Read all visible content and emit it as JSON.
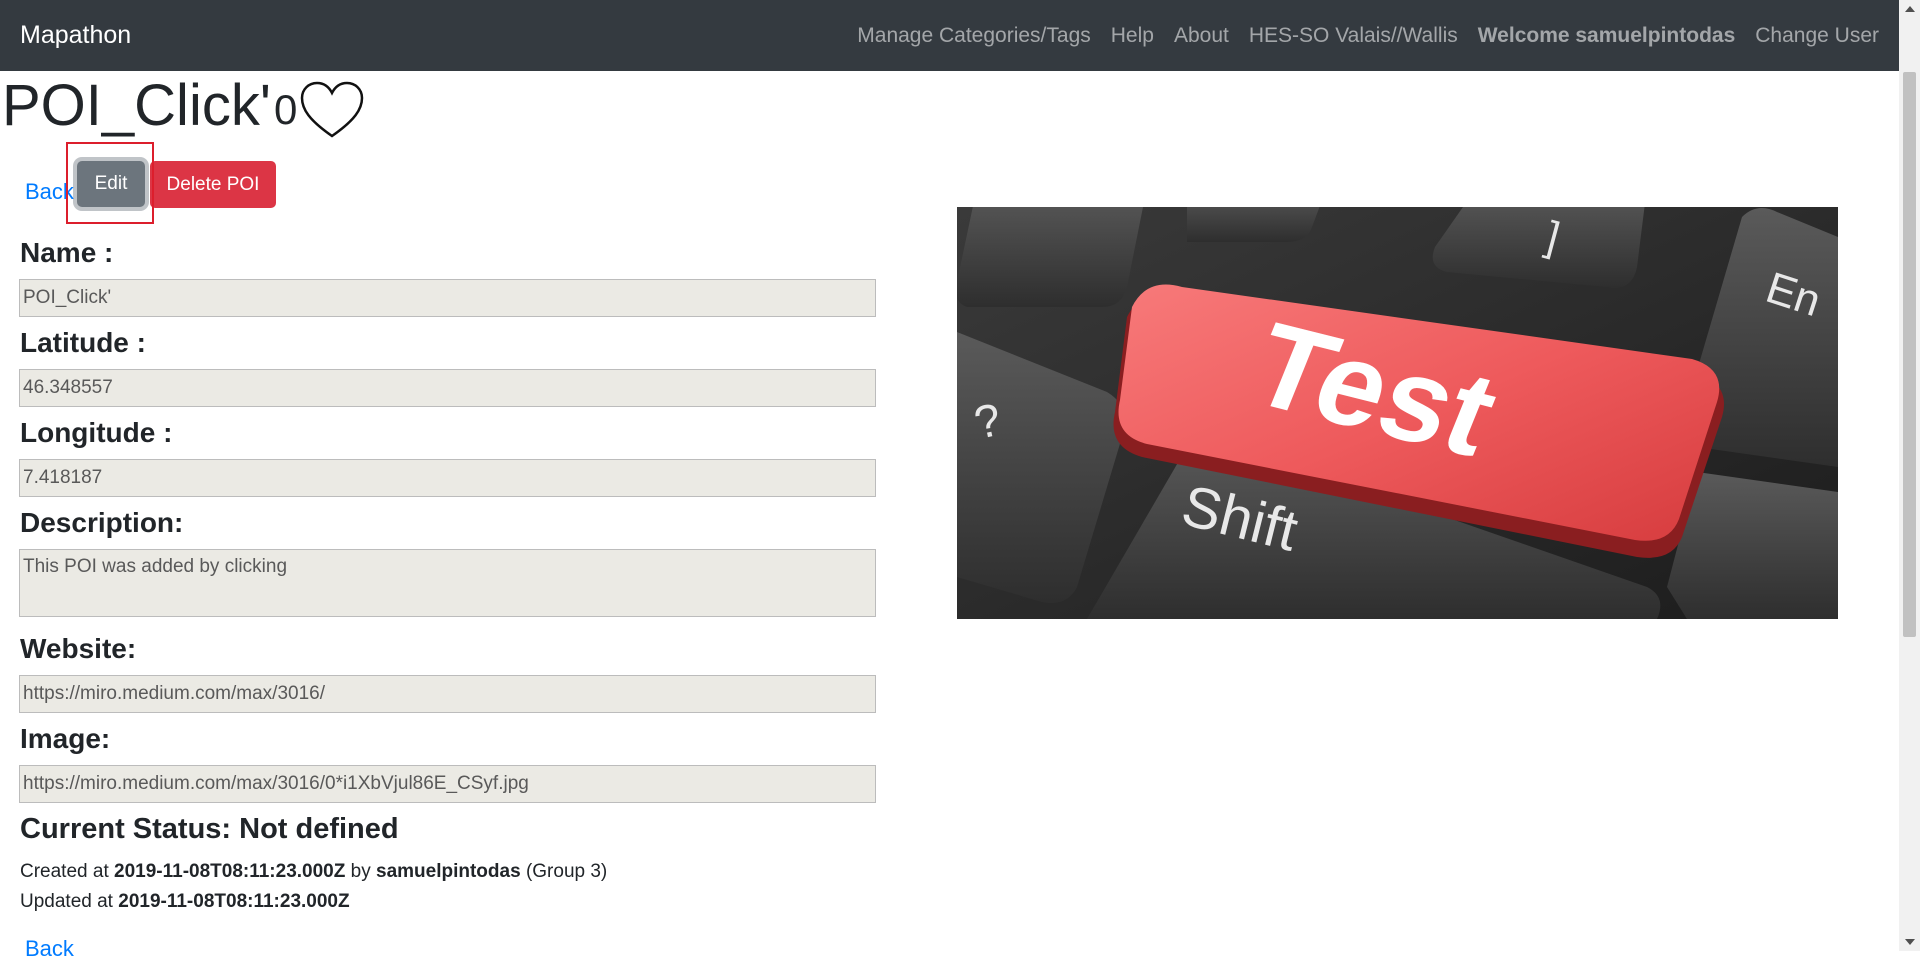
{
  "navbar": {
    "brand": "Mapathon",
    "links": [
      "Manage Categories/Tags",
      "Help",
      "About",
      "HES-SO Valais//Wallis"
    ],
    "welcome": "Welcome samuelpintodas",
    "change_user": "Change User"
  },
  "poi": {
    "title": "POI_Click'",
    "likes": "0",
    "heart_icon": "heart-outline-icon"
  },
  "actions": {
    "back": "Back",
    "edit": "Edit",
    "delete": "Delete POI"
  },
  "form": {
    "name_label": "Name :",
    "name_value": "POI_Click'",
    "latitude_label": "Latitude :",
    "latitude_value": "46.348557",
    "longitude_label": "Longitude :",
    "longitude_value": "7.418187",
    "description_label": "Description:",
    "description_value": "This POI was added by clicking",
    "website_label": "Website:",
    "website_value": "https://miro.medium.com/max/3016/",
    "image_label": "Image:",
    "image_value": "https://miro.medium.com/max/3016/0*i1XbVjul86E_CSyf.jpg"
  },
  "status": {
    "text": "Current Status: Not defined"
  },
  "meta": {
    "created_prefix": "Created at",
    "created_at": "2019-11-08T08:11:23.000Z",
    "by": "by",
    "creator": "samuelpintodas",
    "group": "(Group 3)",
    "updated_prefix": "Updated at",
    "updated_at": "2019-11-08T08:11:23.000Z"
  },
  "image": {
    "key_text": "Test",
    "shift_text": "Shift",
    "question_text": "?",
    "enter_text": "En",
    "bracket_text": "]"
  },
  "colors": {
    "navbar": "#343a40",
    "link": "#007bff",
    "edit_button": "#6c757d",
    "delete_button": "#dc3545",
    "highlight": "#dc1e2c"
  }
}
